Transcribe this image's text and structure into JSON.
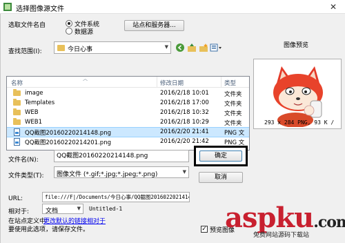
{
  "window": {
    "title": "选择图像源文件",
    "close_glyph": "✕"
  },
  "source": {
    "label": "选取文件名自",
    "options": [
      {
        "label": "文件系统",
        "selected": true
      },
      {
        "label": "数据源",
        "selected": false
      }
    ],
    "sites_button": "站点和服务器..."
  },
  "lookin": {
    "label": "查找范围(I):",
    "value": "今日心事"
  },
  "list": {
    "columns": [
      "名称",
      "修改日期",
      "类型"
    ],
    "rows": [
      {
        "icon": "folder-icon",
        "name": "image",
        "date": "2016/2/18 10:01",
        "type": "文件夹",
        "selected": false
      },
      {
        "icon": "folder-icon",
        "name": "Templates",
        "date": "2016/2/18 17:00",
        "type": "文件夹",
        "selected": false
      },
      {
        "icon": "folder-icon",
        "name": "WEB",
        "date": "2016/2/18 10:32",
        "type": "文件夹",
        "selected": false
      },
      {
        "icon": "folder-icon",
        "name": "WEB1",
        "date": "2016/2/18 10:29",
        "type": "文件夹",
        "selected": false
      },
      {
        "icon": "png-file-icon",
        "name": "QQ截图20160220214148.png",
        "date": "2016/2/20 21:41",
        "type": "PNG 文",
        "selected": true
      },
      {
        "icon": "png-file-icon",
        "name": "QQ截图20160220214201.png",
        "date": "2016/2/20 21:42",
        "type": "PNG 文",
        "selected": false
      }
    ]
  },
  "preview": {
    "title": "图像预览",
    "info": "293 x 284 PNG, 93 K /"
  },
  "filename": {
    "label": "文件名(N):",
    "value": "QQ截图20160220214148.png",
    "ok_button": "确定"
  },
  "filetype": {
    "label": "文件类型(T):",
    "value": "图像文件 (*.gif;*.jpg;*.jpeg;*.png)",
    "cancel_button": "取消"
  },
  "url": {
    "label": "URL:",
    "value": "file:///F|/Documents/今日心事/QQ截图20160220214148"
  },
  "relative": {
    "label": "相对于:",
    "value": "文档",
    "doc": "Untitled-1"
  },
  "site_note": {
    "prefix": "在站点定义中",
    "link": "更改默认的链接相对于"
  },
  "save_note": "要使用此选项，请保存文件。",
  "preview_checkbox": {
    "label": "预览图像",
    "checked": true
  },
  "watermark": {
    "brand": "aspku",
    "tld": ".com",
    "sub": "免费网站源码下载站"
  },
  "colors": {
    "selection": "#cce8ff",
    "link": "#0000ee",
    "wm_asp": "#c8202f",
    "wm_ku": "#222222"
  }
}
